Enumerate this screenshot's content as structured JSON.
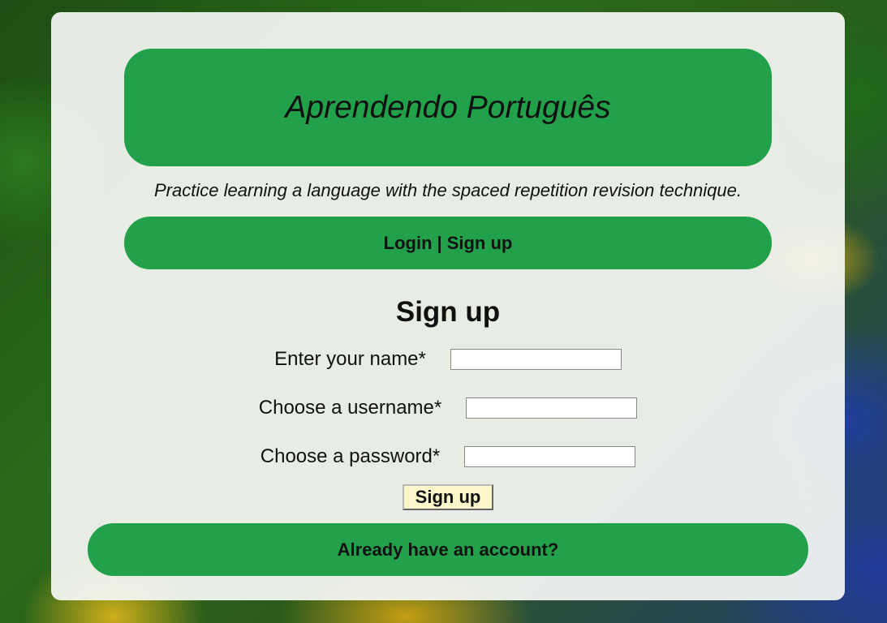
{
  "header": {
    "title": "Aprendendo Português",
    "tagline": "Practice learning a language with the spaced repetition revision technique."
  },
  "nav": {
    "login_label": "Login",
    "separator": "|",
    "signup_label": "Sign up"
  },
  "signup_form": {
    "title": "Sign up",
    "name_label": "Enter your name*",
    "name_value": "",
    "username_label": "Choose a username*",
    "username_value": "",
    "password_label": "Choose a password*",
    "password_value": "",
    "submit_label": "Sign up"
  },
  "footer": {
    "account_link_label": "Already have an account?"
  },
  "colors": {
    "banner_green": "#23a04a",
    "submit_bg": "#fbf6c9",
    "card_bg": "#f5f7f4"
  }
}
